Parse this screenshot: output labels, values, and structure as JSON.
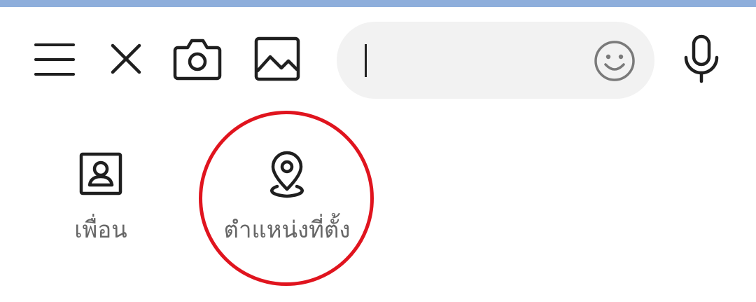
{
  "toolbar": {
    "menu_icon": "menu-icon",
    "close_icon": "close-icon",
    "camera_icon": "camera-icon",
    "image_icon": "image-icon",
    "mic_icon": "microphone-icon"
  },
  "message_input": {
    "value": "",
    "placeholder": "",
    "emoji_icon": "smiley-icon"
  },
  "attachments": {
    "items": [
      {
        "label": "เพื่อน",
        "icon": "contact-card-icon"
      },
      {
        "label": "ตำแหน่งที่ตั้ง",
        "icon": "location-pin-icon"
      }
    ]
  },
  "colors": {
    "top_strip": "#8eaedb",
    "icon_dark": "#1f1f1f",
    "label_gray": "#666666",
    "input_bg": "#f2f2f2",
    "highlight_red": "#e0141e"
  }
}
